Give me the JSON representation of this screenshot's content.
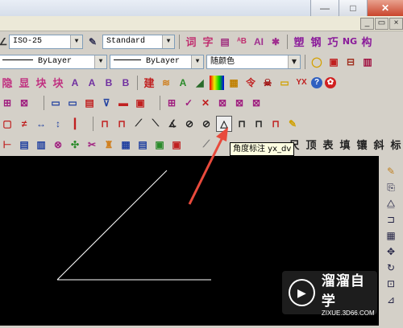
{
  "window": {
    "minimize": "—",
    "maximize": "□",
    "close": "✕"
  },
  "inner_window": {
    "minimize": "_",
    "restore": "▭",
    "close": "×"
  },
  "properties": {
    "dimstyle": "ISO-25",
    "textstyle": "Standard",
    "linetype": "ByLayer",
    "lineweight": "ByLayer",
    "color": "随颜色"
  },
  "toolbar_row1_cjk": [
    "词",
    "字"
  ],
  "toolbar_row1_right": [
    "塑",
    "钢",
    "巧",
    "NG",
    "构"
  ],
  "toolbar_row6_right": [
    "尺",
    "顶",
    "表",
    "填",
    "镶",
    "斜",
    "标"
  ],
  "row3_labels": [
    "隐",
    "显",
    "块",
    "块",
    "A",
    "A",
    "B",
    "B",
    "建",
    "YX"
  ],
  "tooltip": "角度标注 yx_dv",
  "watermark": {
    "brand": "溜溜自学",
    "site": "ZIXUE.3D66.COM"
  },
  "colors": {
    "canvas": "#000000",
    "drawing_lines": "#ffffff",
    "arrow": "#e84a3c",
    "toolbar_bg": "#d4d0c8"
  },
  "drawing": {
    "description_lines": 2
  }
}
